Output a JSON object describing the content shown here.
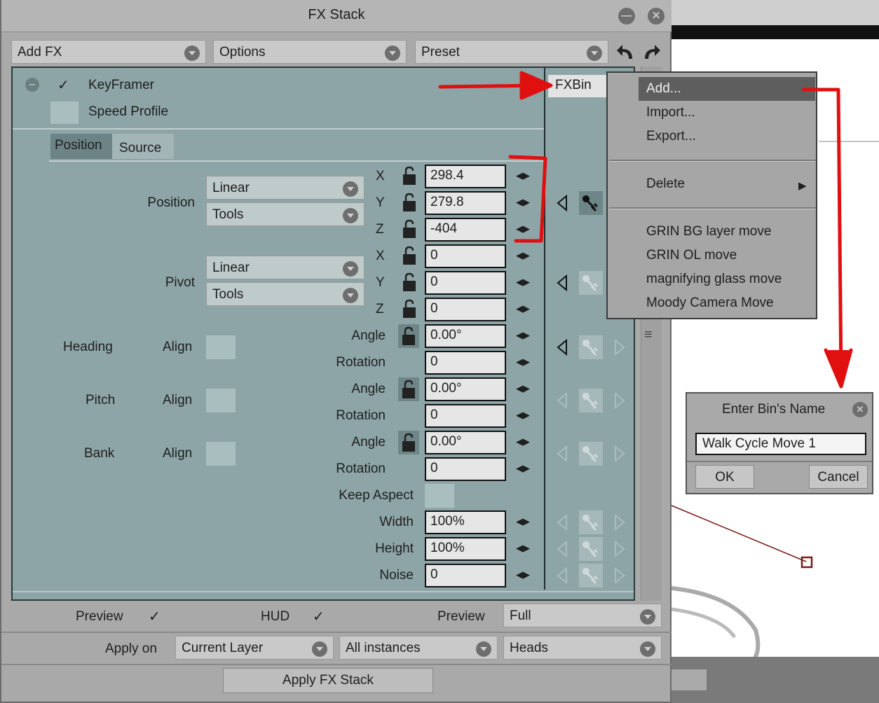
{
  "window": {
    "title": "FX Stack"
  },
  "toolbar": {
    "add_fx": "Add FX",
    "options": "Options",
    "preset": "Preset"
  },
  "effects": [
    {
      "label": "KeyFramer",
      "enabled": true
    },
    {
      "label": "Speed Profile",
      "enabled": false
    }
  ],
  "fxbin": {
    "label": "FXBin"
  },
  "tabs": {
    "position": "Position",
    "source": "Source"
  },
  "position_group": {
    "label": "Position",
    "interp": "Linear",
    "tools": "Tools",
    "x_label": "X",
    "y_label": "Y",
    "z_label": "Z",
    "x": "298.4",
    "y": "279.8",
    "z": "-404"
  },
  "pivot_group": {
    "label": "Pivot",
    "interp": "Linear",
    "tools": "Tools",
    "x_label": "X",
    "y_label": "Y",
    "z_label": "Z",
    "x": "0",
    "y": "0",
    "z": "0"
  },
  "heading": {
    "label": "Heading",
    "align": "Align",
    "angle_label": "Angle",
    "angle": "0.00°",
    "rotation_label": "Rotation",
    "rotation": "0"
  },
  "pitch": {
    "label": "Pitch",
    "align": "Align",
    "angle_label": "Angle",
    "angle": "0.00°",
    "rotation_label": "Rotation",
    "rotation": "0"
  },
  "bank": {
    "label": "Bank",
    "align": "Align",
    "angle_label": "Angle",
    "angle": "0.00°",
    "rotation_label": "Rotation",
    "rotation": "0"
  },
  "keep_aspect": {
    "label": "Keep Aspect"
  },
  "width": {
    "label": "Width",
    "value": "100%"
  },
  "height": {
    "label": "Height",
    "value": "100%"
  },
  "noise": {
    "label": "Noise",
    "value": "0"
  },
  "bottom": {
    "preview_label": "Preview",
    "hud_label": "HUD",
    "preview2_label": "Preview",
    "preview_mode": "Full",
    "apply_on_label": "Apply on",
    "layer": "Current Layer",
    "instances": "All instances",
    "heads": "Heads",
    "apply_button": "Apply FX Stack"
  },
  "fxbin_menu": {
    "items": [
      "Add...",
      "Import...",
      "Export...",
      "Delete",
      "GRIN BG layer move",
      "GRIN OL move",
      "magnifying glass move",
      "Moody Camera Move"
    ]
  },
  "bin_dialog": {
    "title": "Enter Bin's Name",
    "value": "Walk Cycle Move 1",
    "ok": "OK",
    "cancel": "Cancel"
  },
  "colors": {
    "panel": "#a9a9a9",
    "teal": "#8ea5a7",
    "arrow": "#e01010",
    "menu_highlight": "#5e5e5e"
  }
}
